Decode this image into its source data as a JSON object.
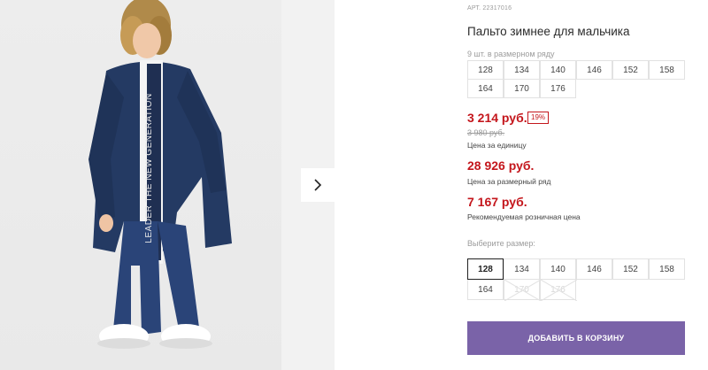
{
  "product": {
    "article": "АРТ. 22317016",
    "title": "Пальто зимнее для мальчика",
    "pack_info": "9 шт. в размерном ряду",
    "pack_sizes": [
      "128",
      "134",
      "140",
      "146",
      "152",
      "158",
      "164",
      "170",
      "176"
    ],
    "price_unit": "3 214 руб.",
    "discount_badge": "19%",
    "old_price": "3 980 руб.",
    "price_unit_caption": "Цена за единицу",
    "price_pack": "28 926 руб.",
    "price_pack_caption": "Цена за размерный ряд",
    "price_retail": "7 167 руб.",
    "price_retail_caption": "Рекомендуемая розничная цена"
  },
  "size_select": {
    "label": "Выберите размер:",
    "options": [
      {
        "size": "128",
        "state": "selected"
      },
      {
        "size": "134",
        "state": "available"
      },
      {
        "size": "140",
        "state": "available"
      },
      {
        "size": "146",
        "state": "available"
      },
      {
        "size": "152",
        "state": "available"
      },
      {
        "size": "158",
        "state": "available"
      },
      {
        "size": "164",
        "state": "available"
      },
      {
        "size": "170",
        "state": "unavailable"
      },
      {
        "size": "176",
        "state": "unavailable"
      }
    ]
  },
  "gallery": {
    "jacket_text": "LEADER THE NEW GENERATION",
    "next_icon": "chevron-right-icon"
  },
  "cart": {
    "add_label": "ДОБАВИТЬ В КОРЗИНУ"
  },
  "colors": {
    "accent": "#7a63a8",
    "price": "#c4161c"
  }
}
